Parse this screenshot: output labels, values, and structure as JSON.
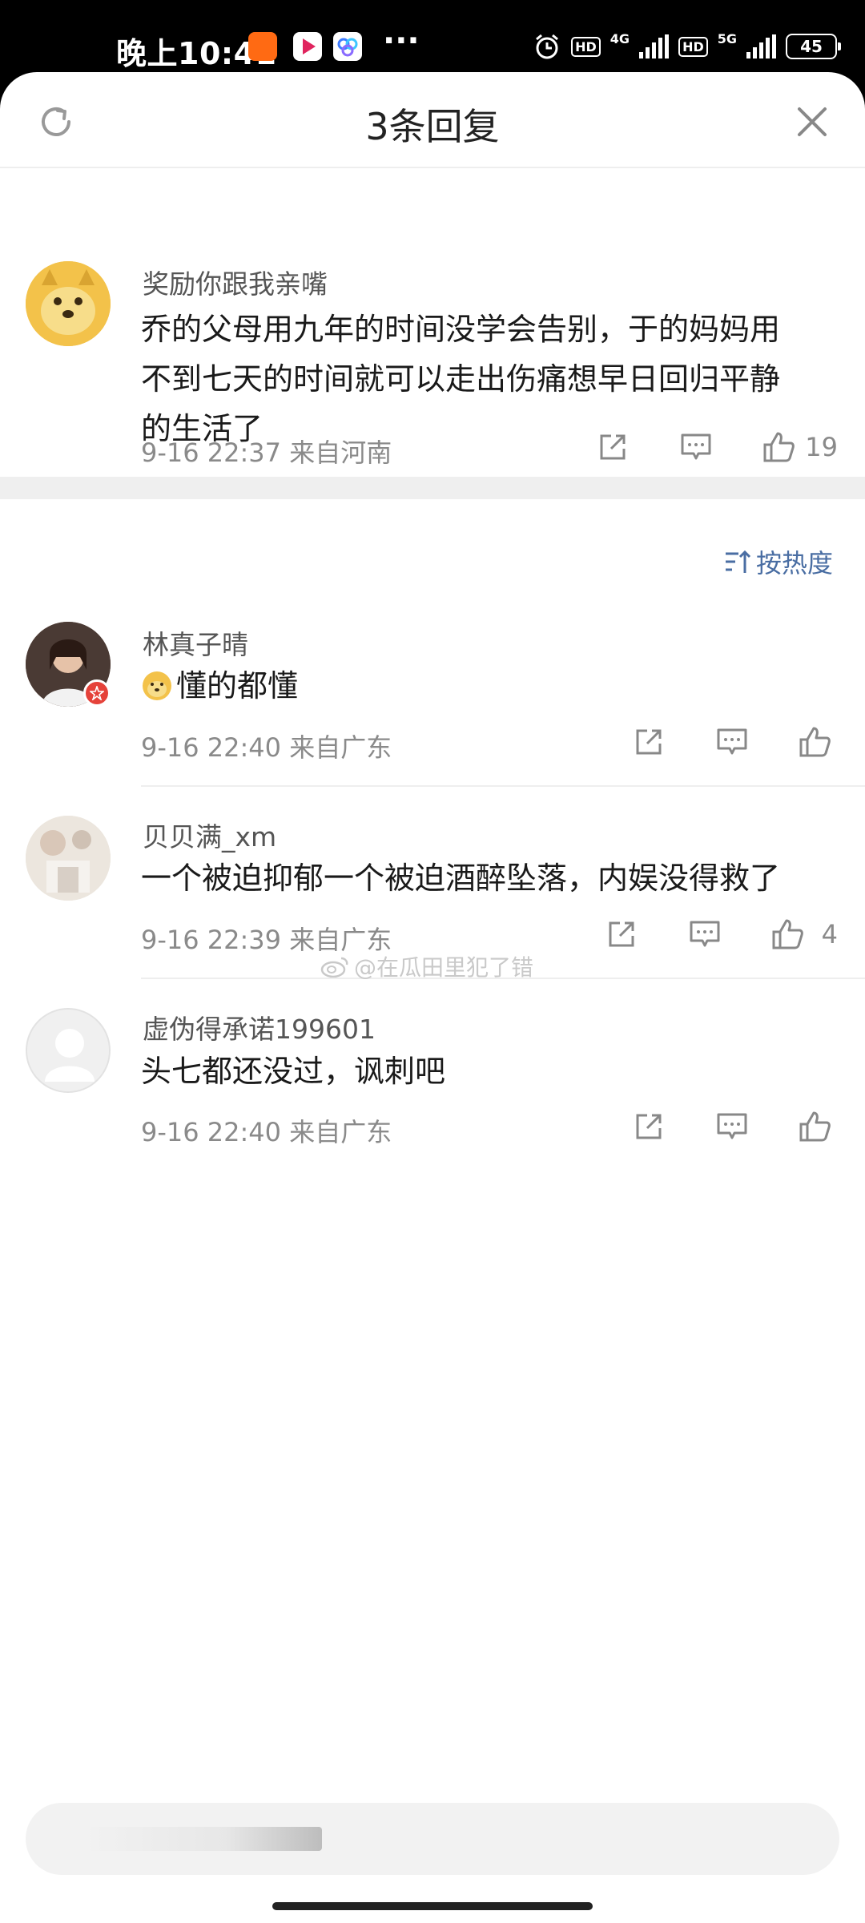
{
  "status_bar": {
    "time": "晚上10:41",
    "network_1": "4G",
    "network_2": "5G",
    "hd_label": "HD",
    "battery": "45",
    "more": "···"
  },
  "header": {
    "title": "3条回复",
    "refresh_icon": "refresh-icon",
    "close_icon": "close-icon"
  },
  "main_comment": {
    "username": "奖励你跟我亲嘴",
    "lines": [
      "乔的父母用九年的时间没学会告别，于的妈妈用",
      "不到七天的时间就可以走出伤痛想早日回归平静",
      "的生活了"
    ],
    "meta": "9-16 22:37  来自河南",
    "likes": "19"
  },
  "sort": {
    "label": "按热度",
    "icon": "sort-icon"
  },
  "replies": [
    {
      "username": "林真子晴",
      "text": "懂的都懂",
      "emoji": "doge-emoji",
      "meta": "9-16 22:40  来自广东",
      "likes": ""
    },
    {
      "username": "贝贝满_xm",
      "text": "一个被迫抑郁一个被迫酒醉坠落，内娱没得救了",
      "meta": "9-16 22:39  来自广东",
      "likes": "4"
    },
    {
      "username": "虚伪得承诺199601",
      "text": "头七都还没过，讽刺吧",
      "meta": "9-16 22:40  来自广东",
      "likes": ""
    }
  ],
  "watermark": "@在瓜田里犯了错",
  "colors": {
    "accent_link": "#4a6ea3",
    "meta_gray": "#8a8a8a",
    "text": "#1a1a1a"
  }
}
